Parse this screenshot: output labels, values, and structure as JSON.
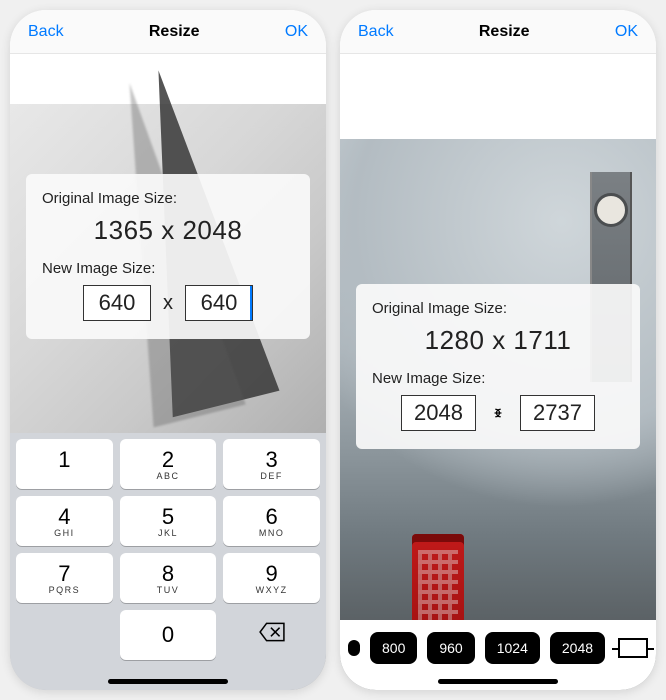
{
  "left": {
    "nav": {
      "back": "Back",
      "title": "Resize",
      "ok": "OK"
    },
    "origLabel": "Original Image Size:",
    "origValue": "1365 x 2048",
    "newLabel": "New Image Size:",
    "width": "640",
    "sep": "x",
    "height": "640",
    "keypad": {
      "k1": "1",
      "k2": "2",
      "k2s": "ABC",
      "k3": "3",
      "k3s": "DEF",
      "k4": "4",
      "k4s": "GHI",
      "k5": "5",
      "k5s": "JKL",
      "k6": "6",
      "k6s": "MNO",
      "k7": "7",
      "k7s": "PQRS",
      "k8": "8",
      "k8s": "TUV",
      "k9": "9",
      "k9s": "WXYZ",
      "k0": "0"
    }
  },
  "right": {
    "nav": {
      "back": "Back",
      "title": "Resize",
      "ok": "OK"
    },
    "origLabel": "Original Image Size:",
    "origValue": "1280 x 1711",
    "newLabel": "New Image Size:",
    "width": "2048",
    "height": "2737",
    "presets": [
      "800",
      "960",
      "1024",
      "2048"
    ]
  }
}
